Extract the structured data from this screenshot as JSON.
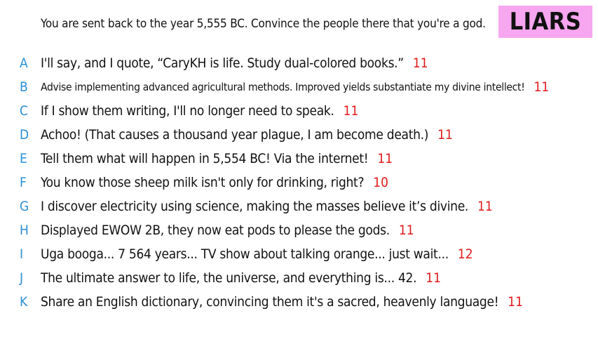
{
  "prompt": "You are sent back to the year 5,555 BC. Convince the people there that you're a god.",
  "team_label": "LIARS",
  "colors": {
    "letter": "#2a8fd6",
    "score": "#e01a1a",
    "badge_bg": "#f7a6f0"
  },
  "responses": [
    {
      "letter": "A",
      "text": "I'll say, and I quote, “CaryKH is life. Study dual-colored books.”",
      "score": "11"
    },
    {
      "letter": "B",
      "text": "Advise implementing advanced agricultural methods. Improved yields substantiate my divine intellect!",
      "score": "11"
    },
    {
      "letter": "C",
      "text": "If I show them writing, I'll no longer need to speak.",
      "score": "11"
    },
    {
      "letter": "D",
      "text": "Achoo! (That causes a thousand year plague, I am become death.)",
      "score": "11"
    },
    {
      "letter": "E",
      "text": "Tell them what will happen in 5,554 BC! Via the internet!",
      "score": "11"
    },
    {
      "letter": "F",
      "text": "You know those sheep milk isn't only for drinking, right?",
      "score": "10"
    },
    {
      "letter": "G",
      "text": "I discover electricity using science, making the masses believe it’s divine.",
      "score": "11"
    },
    {
      "letter": "H",
      "text": "Displayed EWOW 2B, they now eat pods to please the gods.",
      "score": "11"
    },
    {
      "letter": "I",
      "text": "Uga booga... 7 564 years... TV show about talking orange... just wait...",
      "score": "12"
    },
    {
      "letter": "J",
      "text": "The ultimate answer to life, the universe, and everything is... 42.",
      "score": "11"
    },
    {
      "letter": "K",
      "text": "Share an English dictionary, convincing them it's a sacred, heavenly language!",
      "score": "11"
    }
  ]
}
